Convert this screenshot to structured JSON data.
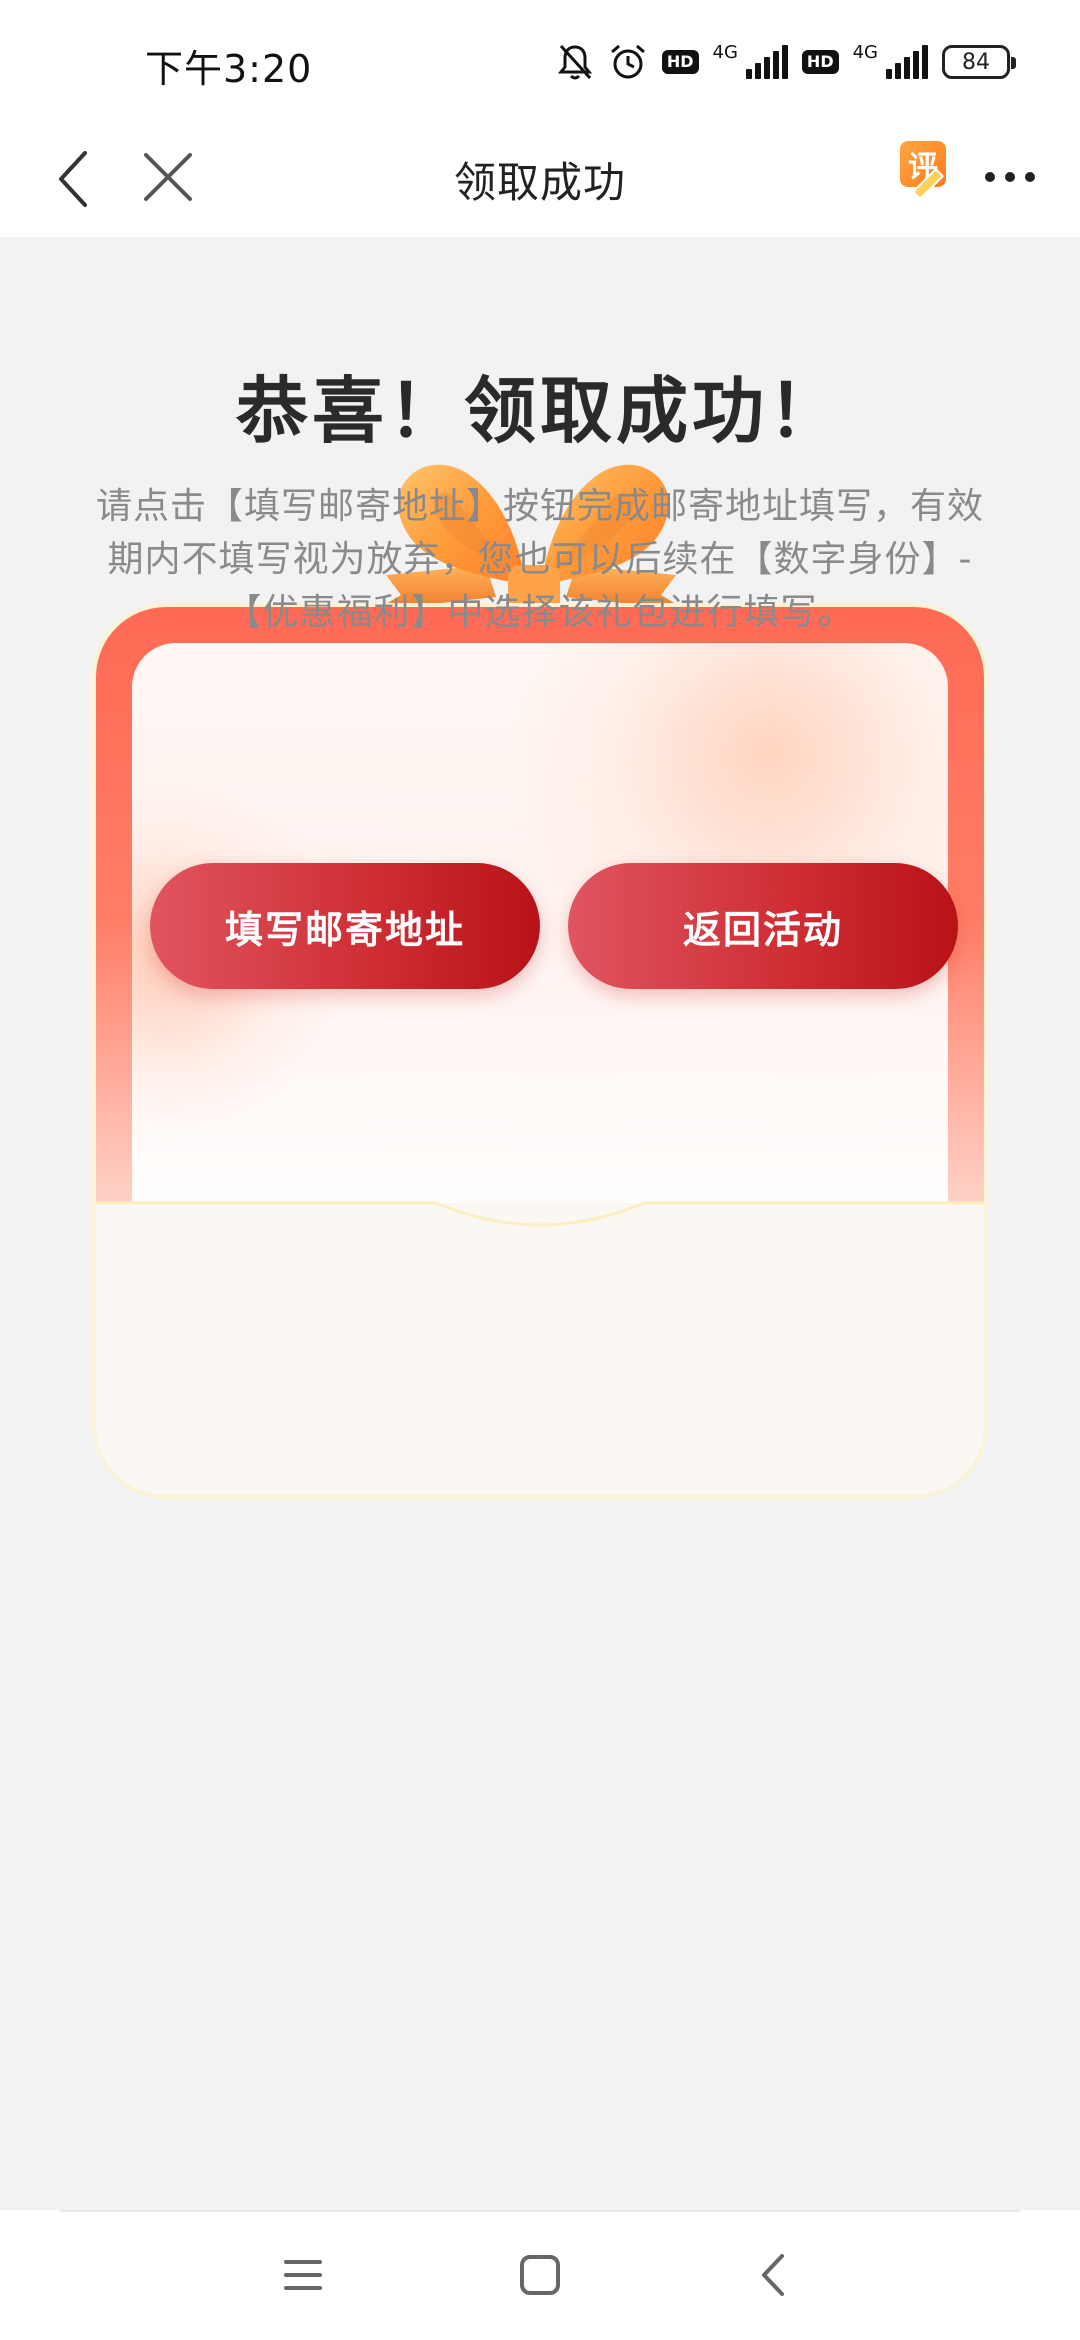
{
  "status_bar": {
    "time": "下午3:20",
    "hd1": "HD",
    "net1": "4G",
    "hd2": "HD",
    "net2": "4G",
    "battery": "84",
    "icons": [
      "bell-off-icon",
      "alarm-icon",
      "signal-icon",
      "battery-icon"
    ]
  },
  "nav": {
    "title": "领取成功",
    "review_label": "评",
    "icons": [
      "back-icon",
      "close-icon",
      "review-icon",
      "more-icon"
    ]
  },
  "gift": {
    "title": "恭喜！领取成功！",
    "description": "请点击【填写邮寄地址】按钮完成邮寄地址填写，有效期内不填写视为放弃，您也可以后续在【数字身份】-【优惠福利】中选择该礼包进行填写。",
    "btn_address": "填写邮寄地址",
    "btn_return": "返回活动"
  },
  "colors": {
    "accent": "#cf2f35",
    "ribbon": "#ff9a3c",
    "frame": "#ff6a55"
  },
  "system_nav": {
    "icons": [
      "menu-icon",
      "home-icon",
      "back-icon"
    ]
  }
}
